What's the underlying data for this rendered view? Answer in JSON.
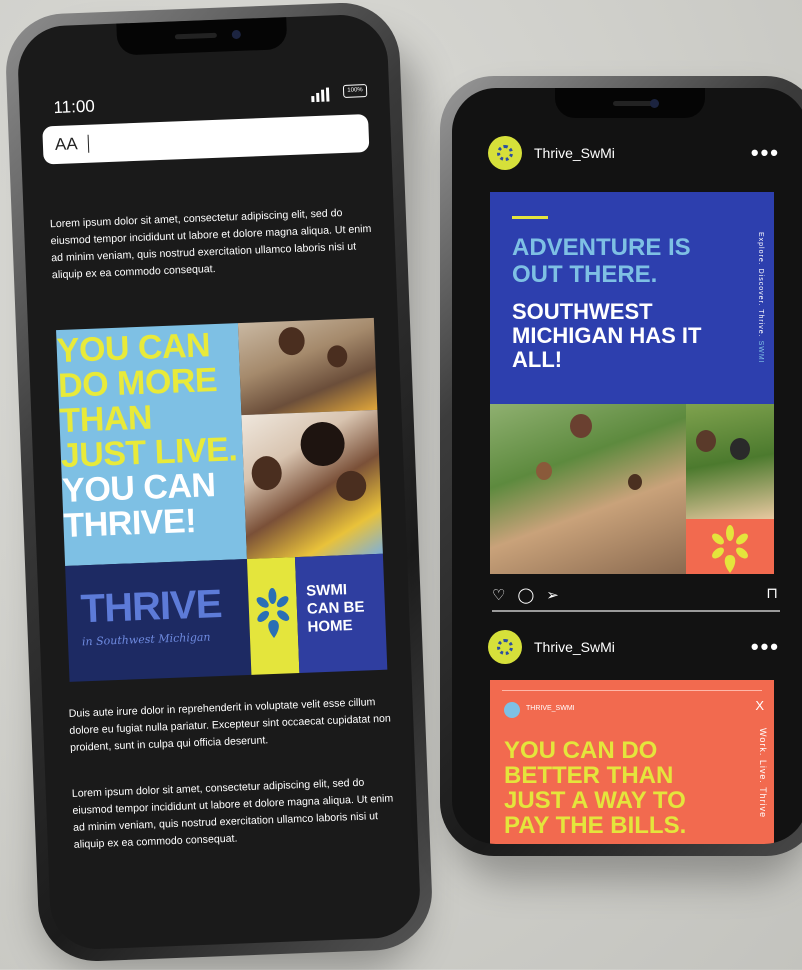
{
  "left_phone": {
    "status": {
      "time": "11:00",
      "battery": "100%"
    },
    "search": {
      "text_size_label": "AA"
    },
    "paragraphs": [
      "Lorem ipsum dolor sit amet, consectetur adipiscing elit, sed do eiusmod tempor incididunt ut labore et dolore magna aliqua. Ut enim ad minim veniam, quis nostrud exercitation ullamco laboris nisi ut aliquip ex ea commodo consequat.",
      "Duis aute irure dolor in reprehenderit in voluptate velit esse cillum dolore eu fugiat nulla pariatur. Excepteur sint occaecat cupidatat non proident, sunt in culpa qui officia deserunt.",
      "Lorem ipsum dolor sit amet, consectetur adipiscing elit, sed do eiusmod tempor incididunt ut labore et dolore magna aliqua. Ut enim ad minim veniam, quis nostrud exercitation ullamco laboris nisi ut aliquip ex ea commodo consequat."
    ],
    "ad": {
      "headline_yellow": "YOU CAN DO MORE THAN JUST LIVE.",
      "headline_white": "YOU CAN THRIVE!",
      "brand_word": "THRIVE",
      "brand_sub": "in Southwest Michigan",
      "swmi_line1": "SWMI",
      "swmi_line2": "CAN BE",
      "swmi_line3": "HOME"
    }
  },
  "right_phone": {
    "post1": {
      "username": "Thrive_SwMi",
      "more_label": "•••",
      "headline_blue": "ADVENTURE IS OUT THERE.",
      "headline_white": "SOUTHWEST MICHIGAN HAS IT ALL!",
      "vertical_text": "Explore. Discover. Thrive.",
      "vertical_highlight": "SWMI"
    },
    "post2": {
      "username": "Thrive_SwMi",
      "more_label": "•••",
      "handle": "THRIVE_SWMI",
      "close_label": "X",
      "headline": "YOU CAN DO BETTER THAN JUST A WAY TO PAY THE BILLS.",
      "vertical_text": "Work. Live. Thrive"
    },
    "icons": [
      "heart-icon",
      "comment-icon",
      "send-icon",
      "bookmark-icon"
    ]
  },
  "colors": {
    "navy": "#1d2a63",
    "royal_blue": "#2d3fae",
    "sky_blue": "#7ec0e4",
    "lime_yellow": "#e4e53c",
    "coral": "#f26a4f"
  }
}
